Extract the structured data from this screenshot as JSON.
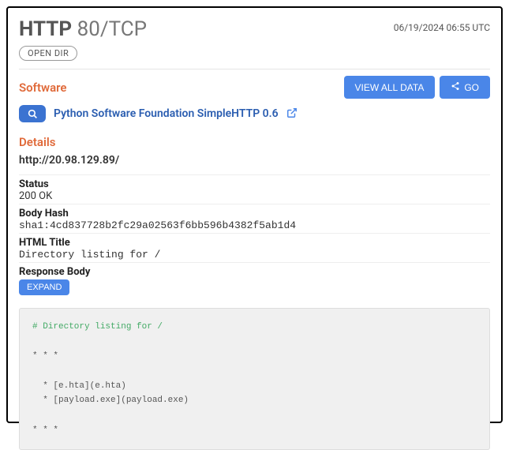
{
  "header": {
    "protocol": "HTTP",
    "port_transport": "80/TCP",
    "timestamp": "06/19/2024 06:55 UTC",
    "badge": "OPEN DIR"
  },
  "buttons": {
    "view_all": "VIEW ALL DATA",
    "go": "GO",
    "expand": "EXPAND"
  },
  "sections": {
    "software": "Software",
    "details": "Details"
  },
  "software": {
    "name": "Python Software Foundation SimpleHTTP 0.6"
  },
  "details": {
    "url": "http://20.98.129.89/",
    "status_label": "Status",
    "status_value": "200 OK",
    "body_hash_label": "Body Hash",
    "body_hash_value": "sha1:4cd837728b2fc29a02563f6bb596b4382f5ab1d4",
    "html_title_label": "HTML Title",
    "html_title_value": "Directory listing for /",
    "response_body_label": "Response Body"
  },
  "response_body": {
    "heading": "# Directory listing for /",
    "sep": "* * *",
    "lines": [
      "  * [e.hta](e.hta)",
      "  * [payload.exe](payload.exe)"
    ]
  }
}
